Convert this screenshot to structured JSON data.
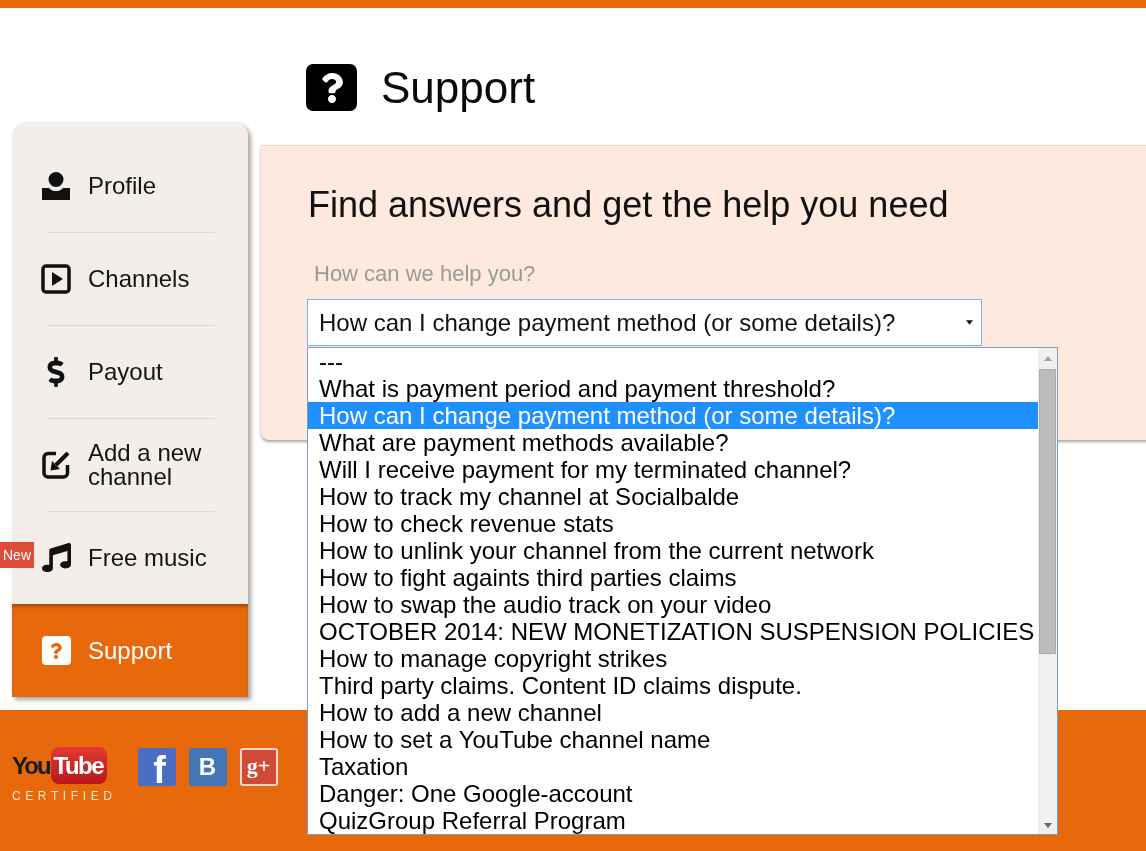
{
  "header": {
    "title": "Support"
  },
  "sidebar": {
    "items": [
      {
        "kind": "profile",
        "label": "Profile",
        "selected": false
      },
      {
        "kind": "channels",
        "label": "Channels",
        "selected": false
      },
      {
        "kind": "payout",
        "label": "Payout",
        "selected": false
      },
      {
        "kind": "add_channel",
        "label": "Add a new channel",
        "selected": false
      },
      {
        "kind": "music",
        "label": "Free music",
        "selected": false,
        "badge": "New"
      },
      {
        "kind": "support",
        "label": "Support",
        "selected": true
      }
    ]
  },
  "help_panel": {
    "heading": "Find answers and get the help you need",
    "question_label": "How can we help you?",
    "select": {
      "value": "How can I change payment method (or some details)?",
      "expanded": true,
      "options": [
        {
          "label": "---",
          "selected": false
        },
        {
          "label": "What is payment period and payment threshold?",
          "selected": false
        },
        {
          "label": "How can I change payment method (or some details)?",
          "selected": true
        },
        {
          "label": "What are payment methods available?",
          "selected": false
        },
        {
          "label": "Will I receive payment for my terminated channel?",
          "selected": false
        },
        {
          "label": "How to track my channel at Socialbalde",
          "selected": false
        },
        {
          "label": "How to check revenue stats",
          "selected": false
        },
        {
          "label": "How to unlink your channel from the current network",
          "selected": false
        },
        {
          "label": "How to fight againts third parties claims",
          "selected": false
        },
        {
          "label": "How to swap the audio track on your video",
          "selected": false
        },
        {
          "label": "OCTOBER 2014: NEW MONETIZATION SUSPENSION POLICIES",
          "selected": false
        },
        {
          "label": "How to manage copyright strikes",
          "selected": false
        },
        {
          "label": "Third party claims. Content ID claims dispute.",
          "selected": false
        },
        {
          "label": "How to add a new channel",
          "selected": false
        },
        {
          "label": "How to set a YouTube channel name",
          "selected": false
        },
        {
          "label": "Taxation",
          "selected": false
        },
        {
          "label": "Danger: One Google-account",
          "selected": false
        },
        {
          "label": "QuizGroup Referral Program",
          "selected": false
        }
      ]
    }
  },
  "footer": {
    "certification": {
      "word_1": "You",
      "word_2": "Tube",
      "caption": "CERTIFIED"
    },
    "social_links": [
      {
        "kind": "facebook",
        "glyph": "f"
      },
      {
        "kind": "vk",
        "glyph": "B"
      },
      {
        "kind": "google_plus",
        "glyph": "g+"
      }
    ]
  }
}
